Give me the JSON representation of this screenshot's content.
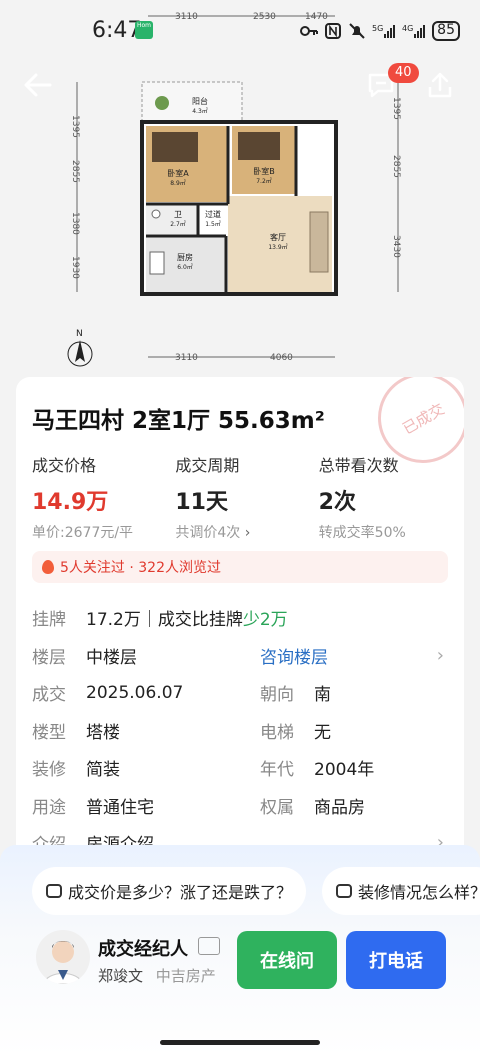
{
  "status_bar": {
    "time": "6:47",
    "battery": "85",
    "app_badge": "Hom"
  },
  "floor_plan": {
    "dims_top": [
      "3110",
      "2530",
      "1470"
    ],
    "dims_bottom": [
      "3110",
      "4060"
    ],
    "dims_left": [
      "1395",
      "2855",
      "1380",
      "1930"
    ],
    "dims_right": [
      "1395",
      "2855",
      "3430"
    ],
    "rooms": [
      {
        "name": "阳台",
        "area": "4.3㎡"
      },
      {
        "name": "卧室A",
        "area": "8.9㎡"
      },
      {
        "name": "卧室B",
        "area": "7.2㎡"
      },
      {
        "name": "卫",
        "area": "2.7㎡"
      },
      {
        "name": "过道",
        "area": "1.5㎡"
      },
      {
        "name": "客厅",
        "area": "13.9㎡"
      },
      {
        "name": "厨房",
        "area": "6.0㎡"
      }
    ],
    "north": "N"
  },
  "header": {
    "message_count": "40"
  },
  "card": {
    "title": "马王四村 2室1厅 55.63m²",
    "stamp": "已成交",
    "stats": [
      {
        "label": "成交价格",
        "value": "14.9万",
        "sub": "单价:2677元/平"
      },
      {
        "label": "成交周期",
        "value": "11天",
        "sub": "共调价4次"
      },
      {
        "label": "总带看次数",
        "value": "2次",
        "sub": "转成交率50%"
      }
    ],
    "attention": "5人关注过 · 322人浏览过",
    "listing": {
      "label": "挂牌",
      "value": "17.2万｜成交比挂牌",
      "delta": "少2万"
    },
    "rows": [
      {
        "l1": "楼层",
        "v1": "中楼层",
        "l2": "",
        "v2": "咨询楼层"
      },
      {
        "l1": "成交",
        "v1": "2025.06.07",
        "l2": "朝向",
        "v2": "南"
      },
      {
        "l1": "楼型",
        "v1": "塔楼",
        "l2": "电梯",
        "v2": "无"
      },
      {
        "l1": "装修",
        "v1": "简装",
        "l2": "年代",
        "v2": "2004年"
      },
      {
        "l1": "用途",
        "v1": "普通住宅",
        "l2": "权属",
        "v2": "商品房"
      },
      {
        "l1": "介绍",
        "v1": "房源介绍",
        "l2": "",
        "v2": ""
      }
    ]
  },
  "sheet": {
    "chips": [
      "成交价是多少？涨了还是跌了？",
      "装修情况怎么样？"
    ],
    "agent_role": "成交经纪人",
    "agent_name": "郑竣文",
    "agent_company": "中吉房产",
    "btn_online": "在线问",
    "btn_call": "打电话"
  }
}
